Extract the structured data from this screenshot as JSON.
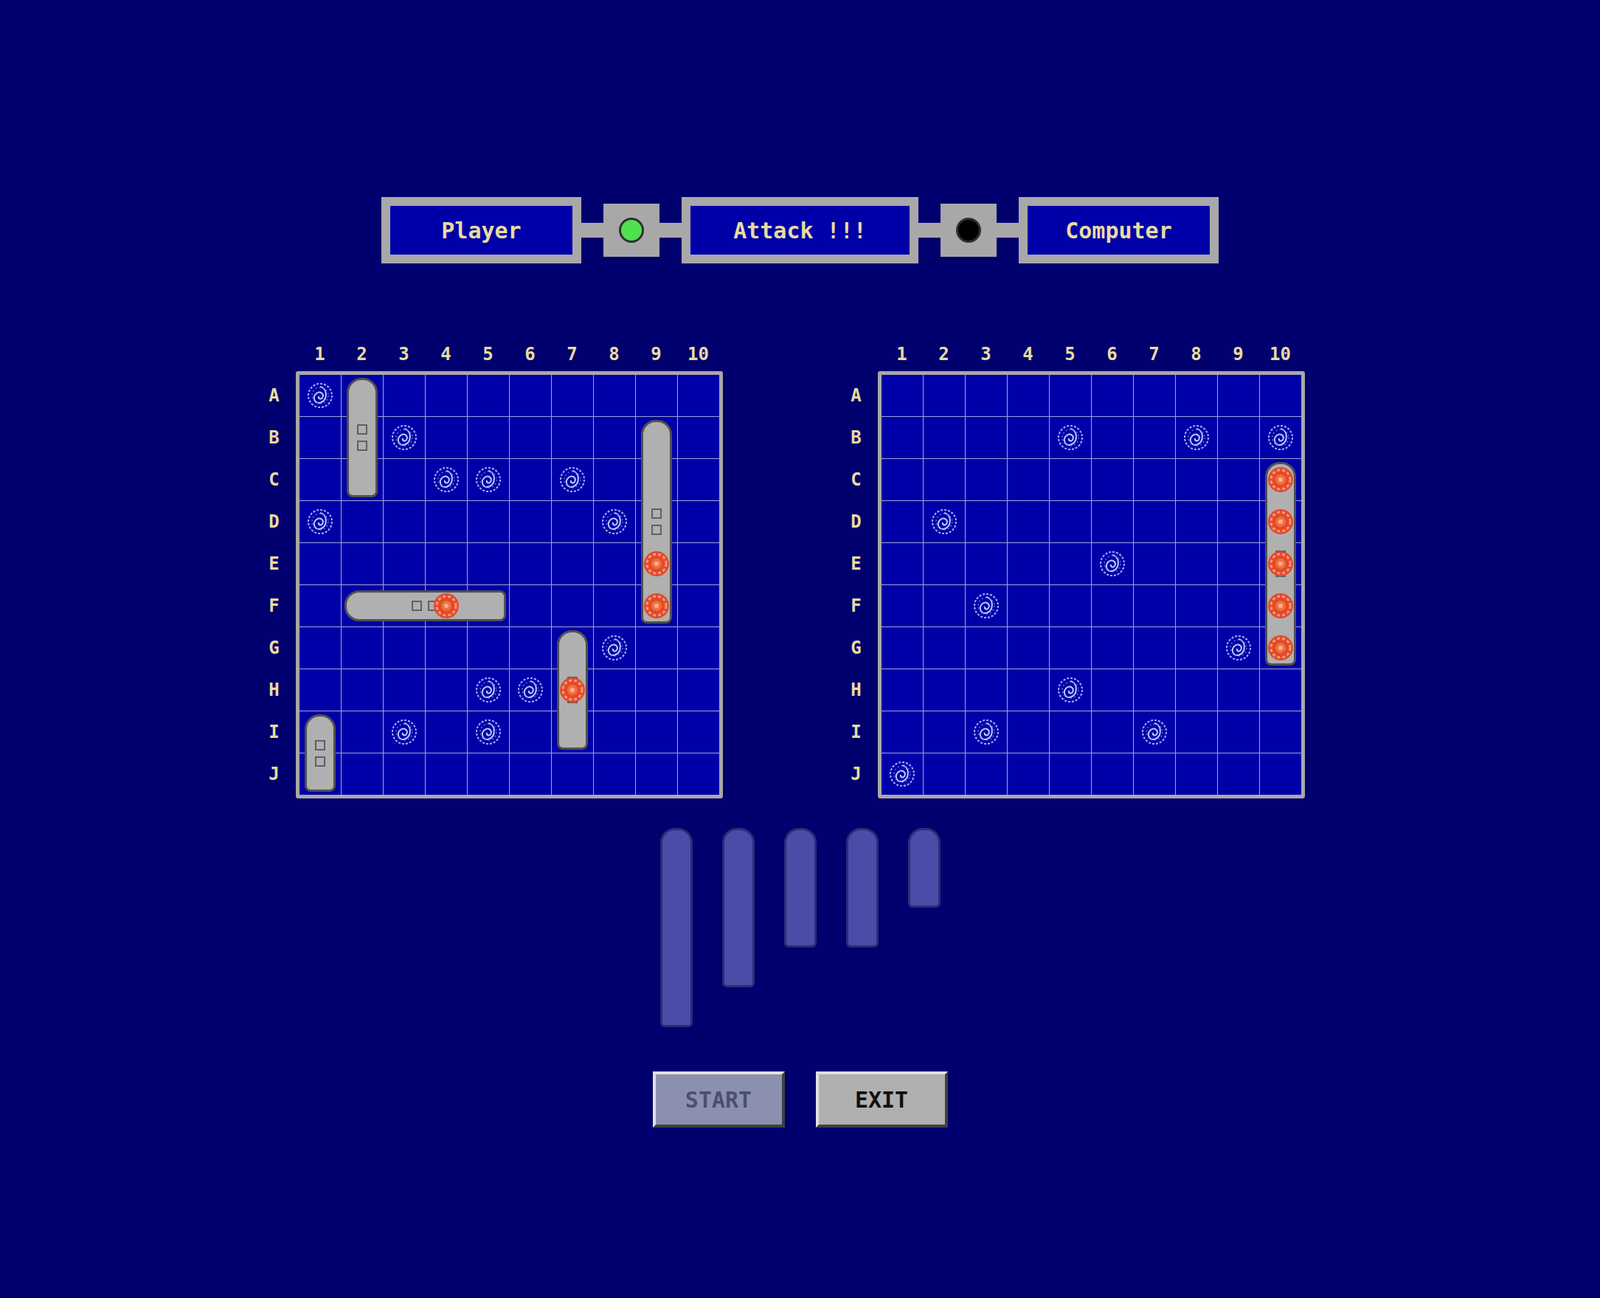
{
  "header": {
    "player": {
      "label": "Player",
      "active": true
    },
    "status": "Attack !!!",
    "computer": {
      "label": "Computer",
      "active": false
    }
  },
  "columns": [
    "1",
    "2",
    "3",
    "4",
    "5",
    "6",
    "7",
    "8",
    "9",
    "10"
  ],
  "rows": [
    "A",
    "B",
    "C",
    "D",
    "E",
    "F",
    "G",
    "H",
    "I",
    "J"
  ],
  "boards": [
    {
      "ships": [
        {
          "start": "A2",
          "length": 3,
          "orientation": "vertical"
        },
        {
          "start": "B9",
          "length": 5,
          "orientation": "vertical"
        },
        {
          "start": "F2",
          "length": 4,
          "orientation": "horizontal"
        },
        {
          "start": "G7",
          "length": 3,
          "orientation": "vertical"
        },
        {
          "start": "I1",
          "length": 2,
          "orientation": "vertical"
        }
      ],
      "shots": [
        {
          "cell": "A1",
          "mark": "miss"
        },
        {
          "cell": "B3",
          "mark": "miss"
        },
        {
          "cell": "C4",
          "mark": "miss"
        },
        {
          "cell": "C5",
          "mark": "miss"
        },
        {
          "cell": "C7",
          "mark": "miss"
        },
        {
          "cell": "D1",
          "mark": "miss"
        },
        {
          "cell": "D8",
          "mark": "miss"
        },
        {
          "cell": "G8",
          "mark": "miss"
        },
        {
          "cell": "H5",
          "mark": "miss"
        },
        {
          "cell": "H6",
          "mark": "miss"
        },
        {
          "cell": "I3",
          "mark": "miss"
        },
        {
          "cell": "I5",
          "mark": "miss"
        },
        {
          "cell": "E9",
          "mark": "hit"
        },
        {
          "cell": "F9",
          "mark": "hit"
        },
        {
          "cell": "F4",
          "mark": "hit"
        },
        {
          "cell": "H7",
          "mark": "hit"
        }
      ]
    },
    {
      "ships": [
        {
          "start": "C10",
          "length": 5,
          "orientation": "vertical"
        }
      ],
      "shots": [
        {
          "cell": "B5",
          "mark": "miss"
        },
        {
          "cell": "B8",
          "mark": "miss"
        },
        {
          "cell": "B10",
          "mark": "miss"
        },
        {
          "cell": "D2",
          "mark": "miss"
        },
        {
          "cell": "E6",
          "mark": "miss"
        },
        {
          "cell": "F3",
          "mark": "miss"
        },
        {
          "cell": "G9",
          "mark": "miss"
        },
        {
          "cell": "H5",
          "mark": "miss"
        },
        {
          "cell": "I3",
          "mark": "miss"
        },
        {
          "cell": "I7",
          "mark": "miss"
        },
        {
          "cell": "J1",
          "mark": "miss"
        },
        {
          "cell": "C10",
          "mark": "hit"
        },
        {
          "cell": "D10",
          "mark": "hit"
        },
        {
          "cell": "E10",
          "mark": "hit"
        },
        {
          "cell": "F10",
          "mark": "hit"
        },
        {
          "cell": "G10",
          "mark": "hit"
        }
      ]
    }
  ],
  "tray": [
    {
      "length": 5,
      "placed": true
    },
    {
      "length": 4,
      "placed": true
    },
    {
      "length": 3,
      "placed": true
    },
    {
      "length": 3,
      "placed": true
    },
    {
      "length": 2,
      "placed": true
    }
  ],
  "buttons": [
    {
      "label": "START",
      "disabled": true
    },
    {
      "label": "EXIT",
      "disabled": false
    }
  ]
}
